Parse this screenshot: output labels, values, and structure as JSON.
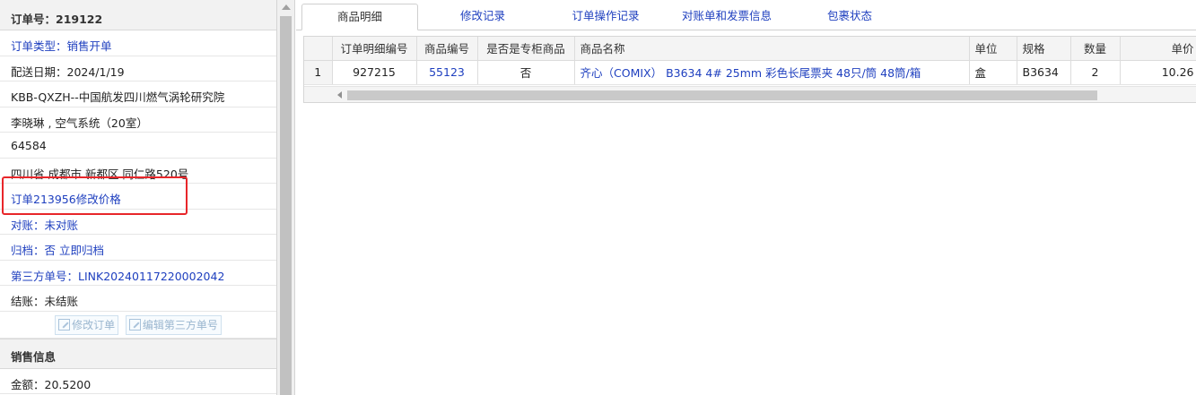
{
  "order_panel": {
    "title": "订单号：219122",
    "rows": [
      {
        "text": "订单类型：销售开单",
        "blue": true
      },
      {
        "text": "配送日期：2024/1/19",
        "blue": false
      },
      {
        "text": "KBB-QXZH--中国航发四川燃气涡轮研究院",
        "blue": false
      },
      {
        "text": "李晓琳 , 空气系统（20室）",
        "blue": false
      },
      {
        "text": "64584",
        "blue": false
      },
      {
        "text": "四川省 成都市 新都区 同仁路520号",
        "blue": false
      },
      {
        "text": "订单213956修改价格",
        "blue": true
      },
      {
        "text": "对账：未对账",
        "blue": true
      },
      {
        "text": "归档：否 立即归档",
        "blue": true
      },
      {
        "text": "第三方单号：LINK20240117220002042",
        "blue": true
      },
      {
        "text": "结账：未结账",
        "blue": false
      }
    ],
    "buttons": {
      "edit_order": "修改订单",
      "edit_third_party": "编辑第三方单号"
    },
    "sales_section": {
      "title": "销售信息",
      "amount": "金额：20.5200"
    }
  },
  "tabs": [
    {
      "label": "商品明细",
      "active": true
    },
    {
      "label": "修改记录",
      "active": false
    },
    {
      "label": "订单操作记录",
      "active": false
    },
    {
      "label": "对账单和发票信息",
      "active": false
    },
    {
      "label": "包裹状态",
      "active": false
    }
  ],
  "grid": {
    "columns": [
      "订单明细编号",
      "商品编号",
      "是否是专柜商品",
      "商品名称",
      "单位",
      "规格",
      "数量",
      "单价"
    ],
    "rows": [
      {
        "index": "1",
        "detail_id": "927215",
        "product_id": "55123",
        "is_counter": "否",
        "name": "齐心（COMIX） B3634 4# 25mm 彩色长尾票夹 48只/筒 48筒/箱",
        "unit": "盒",
        "spec": "B3634",
        "qty": "2",
        "price": "10.26"
      }
    ]
  },
  "colors": {
    "link_blue": "#1e3fbf",
    "highlight_red": "#e8262a"
  }
}
